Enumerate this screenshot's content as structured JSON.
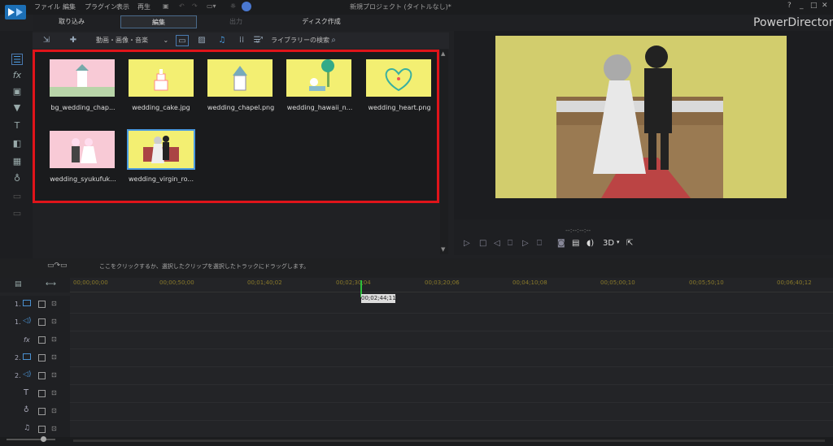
{
  "menu": [
    "ファイル",
    "編集",
    "プラグイン",
    "表示",
    "再生"
  ],
  "window_title": "新規プロジェクト (タイトルなし)*",
  "window_buttons": [
    "?",
    "_",
    "□",
    "✕"
  ],
  "modes": {
    "import": "取り込み",
    "edit": "編集",
    "output": "出力",
    "disc": "ディスク作成"
  },
  "brand": "PowerDirector",
  "library": {
    "filter_label": "動画・画像・音楽",
    "search_label": "ライブラリーの検索",
    "items": [
      {
        "name": "bg_wedding_chap...",
        "color": "#f8c9d6"
      },
      {
        "name": "wedding_cake.jpg",
        "color": "#f3ef72"
      },
      {
        "name": "wedding_chapel.png",
        "color": "#f3ef72"
      },
      {
        "name": "wedding_hawaii_n...",
        "color": "#f3ef72"
      },
      {
        "name": "wedding_heart.png",
        "color": "#f3ef72"
      },
      {
        "name": "wedding_syukufuk...",
        "color": "#f3ef72"
      },
      {
        "name": "wedding_virgin_ro...",
        "color": "#f3ef72"
      }
    ],
    "highlight_color": "#e0141a"
  },
  "preview": {
    "timecode": "--:--:--:--",
    "mode_3d": "3D"
  },
  "timeline": {
    "hint": "ここをクリックするか、選択したクリップを選択したトラックにドラッグします。",
    "ruler": [
      "00;00;00;00",
      "00;00;50;00",
      "00;01;40;02",
      "00;02;30;04",
      "00;03;20;06",
      "00;04;10;08",
      "00;05;00;10",
      "00;05;50;10",
      "00;06;40;12"
    ],
    "playhead_time": "00;02;44;11",
    "tracks": [
      {
        "label": "1.",
        "icon": "video-track-icon"
      },
      {
        "label": "1.",
        "icon": "audio-track-icon"
      },
      {
        "label": "fx",
        "icon": "fx-track-icon"
      },
      {
        "label": "2.",
        "icon": "video-track-icon"
      },
      {
        "label": "2.",
        "icon": "audio-track-icon"
      },
      {
        "label": "T",
        "icon": "title-track-icon"
      },
      {
        "label": "",
        "icon": "voice-track-icon"
      },
      {
        "label": "",
        "icon": "music-track-icon"
      }
    ]
  }
}
